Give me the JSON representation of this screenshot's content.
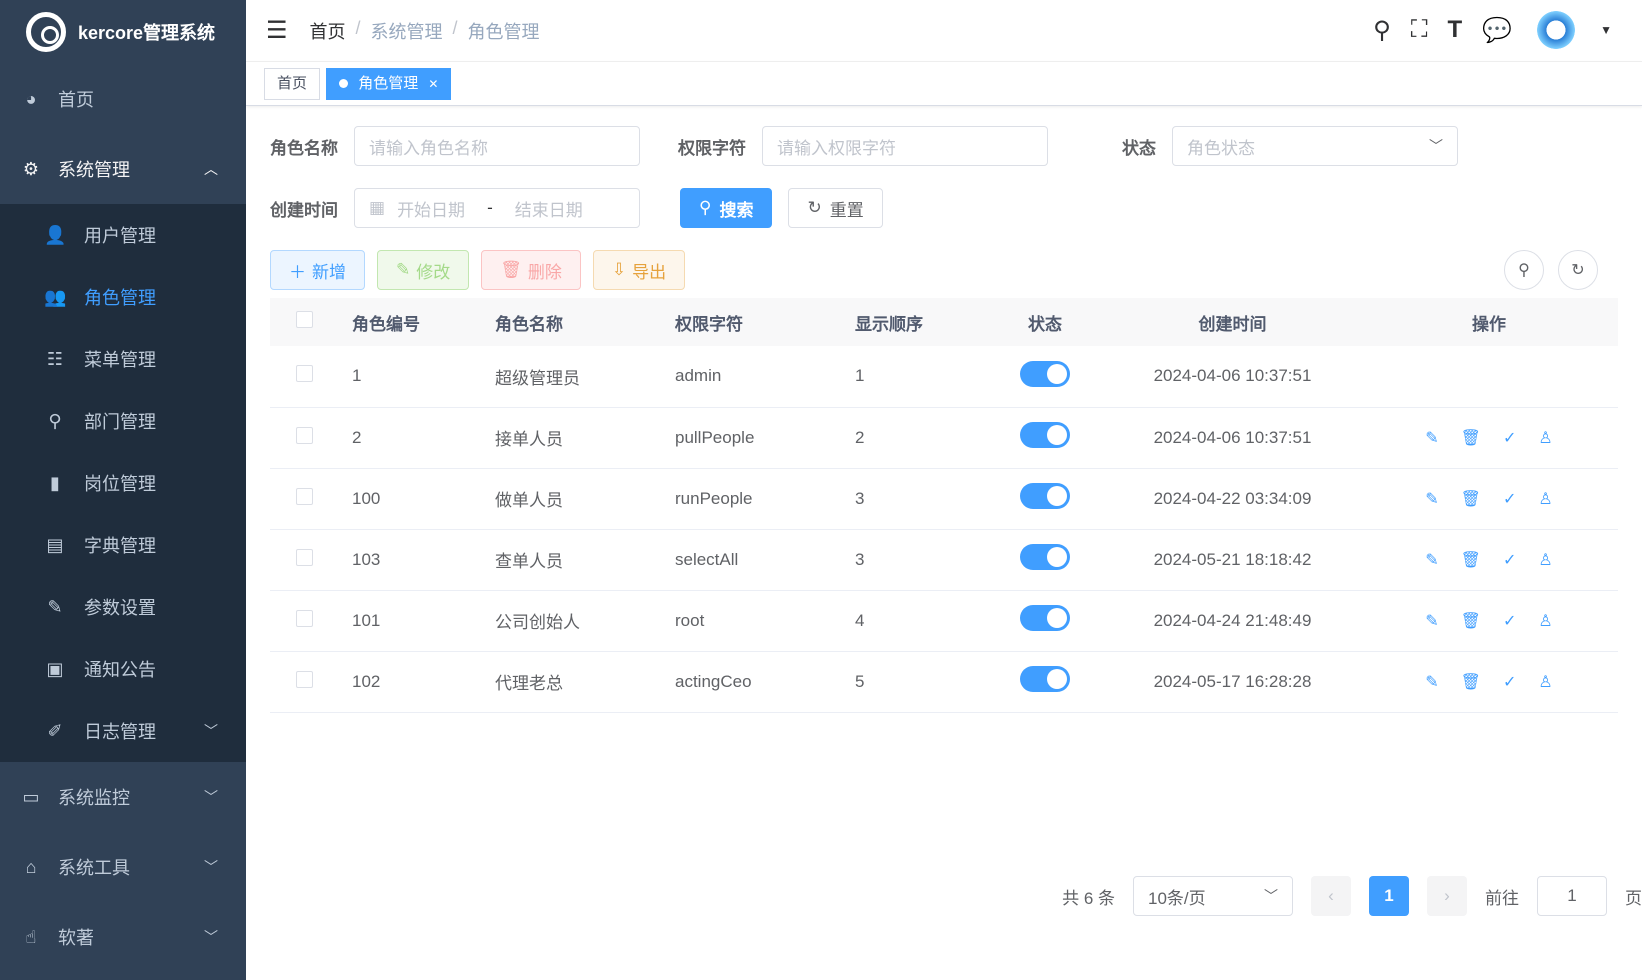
{
  "app": {
    "title": "kercore管理系统"
  },
  "sidebar": {
    "home": "首页",
    "system": "系统管理",
    "sub": [
      "用户管理",
      "角色管理",
      "菜单管理",
      "部门管理",
      "岗位管理",
      "字典管理",
      "参数设置",
      "通知公告",
      "日志管理"
    ],
    "monitor": "系统监控",
    "tools": "系统工具",
    "soft": "软著"
  },
  "breadcrumb": [
    "首页",
    "系统管理",
    "角色管理"
  ],
  "tags": [
    "首页",
    "角色管理"
  ],
  "search": {
    "role_name_label": "角色名称",
    "role_name_placeholder": "请输入角色名称",
    "perm_label": "权限字符",
    "perm_placeholder": "请输入权限字符",
    "status_label": "状态",
    "status_placeholder": "角色状态",
    "created_label": "创建时间",
    "start_placeholder": "开始日期",
    "range_sep": "-",
    "end_placeholder": "结束日期",
    "search_btn": "搜索",
    "reset_btn": "重置"
  },
  "toolbar": {
    "add": "新增",
    "edit": "修改",
    "delete": "删除",
    "export": "导出"
  },
  "table": {
    "headers": [
      "角色编号",
      "角色名称",
      "权限字符",
      "显示顺序",
      "状态",
      "创建时间",
      "操作"
    ],
    "rows": [
      {
        "id": "1",
        "name": "超级管理员",
        "key": "admin",
        "sort": "1",
        "enabled": true,
        "created": "2024-04-06 10:37:51",
        "ops": false
      },
      {
        "id": "2",
        "name": "接单人员",
        "key": "pullPeople",
        "sort": "2",
        "enabled": true,
        "created": "2024-04-06 10:37:51",
        "ops": true
      },
      {
        "id": "100",
        "name": "做单人员",
        "key": "runPeople",
        "sort": "3",
        "enabled": true,
        "created": "2024-04-22 03:34:09",
        "ops": true
      },
      {
        "id": "103",
        "name": "查单人员",
        "key": "selectAll",
        "sort": "3",
        "enabled": true,
        "created": "2024-05-21 18:18:42",
        "ops": true
      },
      {
        "id": "101",
        "name": "公司创始人",
        "key": "root",
        "sort": "4",
        "enabled": true,
        "created": "2024-04-24 21:48:49",
        "ops": true
      },
      {
        "id": "102",
        "name": "代理老总",
        "key": "actingCeo",
        "sort": "5",
        "enabled": true,
        "created": "2024-05-17 16:28:28",
        "ops": true
      }
    ]
  },
  "pagination": {
    "total": "共 6 条",
    "page_size": "10条/页",
    "current": "1",
    "goto": "前往",
    "page_input": "1",
    "page_unit": "页"
  },
  "colors": {
    "sidebar_bg": "#304156",
    "submenu_bg": "#1f2d3d",
    "primary": "#409eff"
  }
}
